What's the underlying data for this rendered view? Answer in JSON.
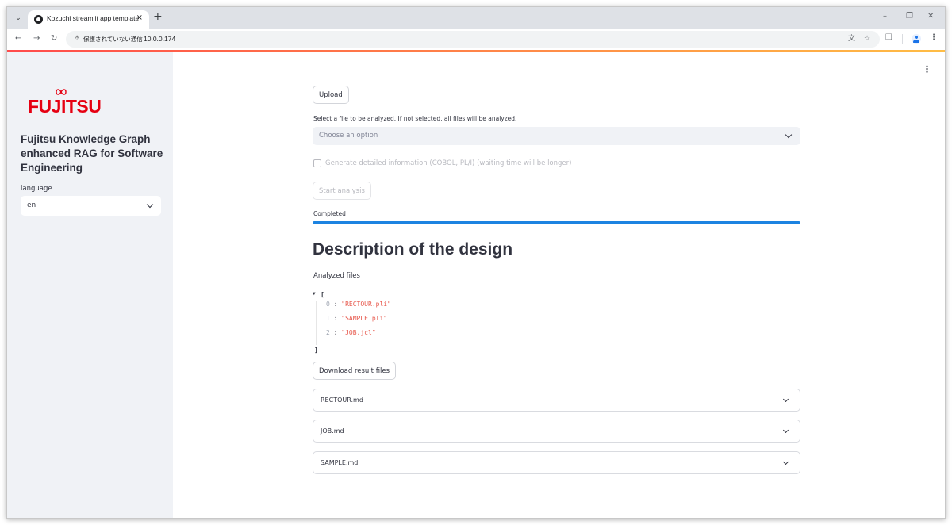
{
  "browser": {
    "tab_title": "Kozuchi streamlit app template",
    "tab_close": "×",
    "new_tab": "+",
    "security_label": "保護されていない通信",
    "url": "10.0.0.174",
    "icons": [
      "tab-search-icon",
      "favicon-icon",
      "back-arrow-icon",
      "forward-arrow-icon",
      "reload-icon",
      "warning-icon",
      "translate-icon",
      "star-icon",
      "extensions-icon",
      "profile-icon",
      "kebab-menu-icon"
    ]
  },
  "sidebar": {
    "logo_text": "FUJITSU",
    "title": "Fujitsu Knowledge Graph enhanced RAG for Software Engineering",
    "language_label": "language",
    "language_value": "en"
  },
  "main": {
    "upload_label": "Upload",
    "file_select_caption": "Select a file to be analyzed. If not selected, all files will be analyzed.",
    "file_select_placeholder": "Choose an option",
    "checkbox_label": "Generate detailed information (COBOL, PL/I) (waiting time will be longer)",
    "checkbox_checked": false,
    "start_label": "Start analysis",
    "progress_label": "Completed",
    "progress_value": 1.0,
    "heading": "Description of the design",
    "analyzed_files_label": "Analyzed files",
    "json_open": "[",
    "json_close": "]",
    "analyzed_files": [
      {
        "index": "0",
        "value": "\"RECTOUR.pli\""
      },
      {
        "index": "1",
        "value": "\"SAMPLE.pli\""
      },
      {
        "index": "2",
        "value": "\"JOB.jcl\""
      }
    ],
    "download_label": "Download result files",
    "expanders": [
      "RECTOUR.md",
      "JOB.md",
      "SAMPLE.md"
    ]
  },
  "colors": {
    "accent": "#1c83e1",
    "logo_red": "#e60012",
    "sidebar_bg": "#f0f2f6",
    "text": "#31333f"
  }
}
